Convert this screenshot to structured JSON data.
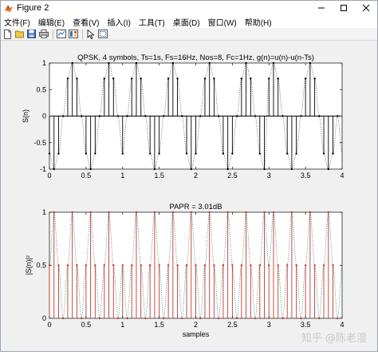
{
  "window": {
    "title": "Figure 2"
  },
  "menu": [
    "文件(F)",
    "编辑(E)",
    "查看(V)",
    "插入(I)",
    "工具(T)",
    "桌面(D)",
    "窗口(W)",
    "帮助(H)"
  ],
  "toolbar_icons": [
    "new-file-icon",
    "open-folder-icon",
    "save-icon",
    "print-icon",
    "link-plot-icon",
    "insert-colorbar-icon",
    "pointer-icon",
    "edit-plot-icon"
  ],
  "watermark": {
    "text": "知乎 @陈老湿"
  },
  "chart_data": [
    {
      "type": "line",
      "title": "QPSK, 4 symbols, Ts=1s, Fs=16Hz, Nos=8, Fc=1Hz, g(n)=u(n)-u(n-Ts)",
      "xlabel": "",
      "ylabel": "S(n)",
      "xlim": [
        0,
        4
      ],
      "ylim": [
        -1,
        1
      ],
      "xticks": [
        "0",
        "0.5",
        "1",
        "1.5",
        "2",
        "2.5",
        "3",
        "3.5",
        "4"
      ],
      "yticks": [
        "-1",
        "-0.5",
        "0",
        "0.5",
        "1"
      ],
      "grid": false,
      "series": [
        {
          "style": "stem",
          "color": "#000000",
          "x": [
            0,
            0.0625,
            0.125,
            0.1875,
            0.25,
            0.3125,
            0.375,
            0.4375,
            0.5,
            0.5625,
            0.625,
            0.6875,
            0.75,
            0.8125,
            0.875,
            0.9375,
            1,
            1.0625,
            1.125,
            1.1875,
            1.25,
            1.3125,
            1.375,
            1.4375,
            1.5,
            1.5625,
            1.625,
            1.6875,
            1.75,
            1.8125,
            1.875,
            1.9375,
            2,
            2.0625,
            2.125,
            2.1875,
            2.25,
            2.3125,
            2.375,
            2.4375,
            2.5,
            2.5625,
            2.625,
            2.6875,
            2.75,
            2.8125,
            2.875,
            2.9375,
            3,
            3.0625,
            3.125,
            3.1875,
            3.25,
            3.3125,
            3.375,
            3.4375,
            3.5,
            3.5625,
            3.625,
            3.6875,
            3.75,
            3.8125,
            3.875,
            3.9375
          ],
          "y": [
            -0.707,
            -1,
            -0.707,
            0,
            0.707,
            1,
            0.707,
            0,
            -0.707,
            -1,
            -0.707,
            0,
            0.707,
            1,
            0.707,
            0,
            -0.707,
            0,
            0.707,
            1,
            0.707,
            0,
            -0.707,
            -1,
            -0.707,
            0,
            0.707,
            1,
            0.707,
            0,
            -0.707,
            -1,
            -0.707,
            0,
            0.707,
            1,
            0.707,
            0,
            -0.707,
            -1,
            -0.707,
            0,
            0.707,
            1,
            0.707,
            0,
            -0.707,
            -1,
            0.707,
            1,
            0.707,
            0,
            -0.707,
            -1,
            -0.707,
            0,
            0.707,
            1,
            0.707,
            0,
            -0.707,
            -1,
            -0.707,
            0
          ]
        },
        {
          "style": "dotted",
          "color": "#555555",
          "note": "continuous passband waveform"
        }
      ]
    },
    {
      "type": "line",
      "title": "PAPR = 3.01dB",
      "xlabel": "samples",
      "ylabel": "|S(n)|²",
      "xlim": [
        0,
        4
      ],
      "ylim": [
        0,
        1
      ],
      "xticks": [
        "0",
        "0.5",
        "1",
        "1.5",
        "2",
        "2.5",
        "3",
        "3.5",
        "4"
      ],
      "yticks": [
        "0",
        "0.5",
        "1"
      ],
      "grid": false,
      "series": [
        {
          "style": "stem",
          "color": "#c0392b",
          "x": [
            0,
            0.0625,
            0.125,
            0.1875,
            0.25,
            0.3125,
            0.375,
            0.4375,
            0.5,
            0.5625,
            0.625,
            0.6875,
            0.75,
            0.8125,
            0.875,
            0.9375,
            1,
            1.0625,
            1.125,
            1.1875,
            1.25,
            1.3125,
            1.375,
            1.4375,
            1.5,
            1.5625,
            1.625,
            1.6875,
            1.75,
            1.8125,
            1.875,
            1.9375,
            2,
            2.0625,
            2.125,
            2.1875,
            2.25,
            2.3125,
            2.375,
            2.4375,
            2.5,
            2.5625,
            2.625,
            2.6875,
            2.75,
            2.8125,
            2.875,
            2.9375,
            3,
            3.0625,
            3.125,
            3.1875,
            3.25,
            3.3125,
            3.375,
            3.4375,
            3.5,
            3.5625,
            3.625,
            3.6875,
            3.75,
            3.8125,
            3.875,
            3.9375
          ],
          "y": [
            0.5,
            1,
            0.5,
            0,
            0.5,
            1,
            0.5,
            0,
            0.5,
            1,
            0.5,
            0,
            0.5,
            1,
            0.5,
            0,
            0.5,
            0,
            0.5,
            1,
            0.5,
            0,
            0.5,
            1,
            0.5,
            0,
            0.5,
            1,
            0.5,
            0,
            0.5,
            1,
            0.5,
            0,
            0.5,
            1,
            0.5,
            0,
            0.5,
            1,
            0.5,
            0,
            0.5,
            1,
            0.5,
            0,
            0.5,
            1,
            0.5,
            1,
            0.5,
            0,
            0.5,
            1,
            0.5,
            0,
            0.5,
            1,
            0.5,
            0,
            0.5,
            1,
            0.5,
            0
          ]
        },
        {
          "style": "dotted",
          "color": "#2e7d6e",
          "note": "continuous power envelope"
        }
      ]
    }
  ]
}
